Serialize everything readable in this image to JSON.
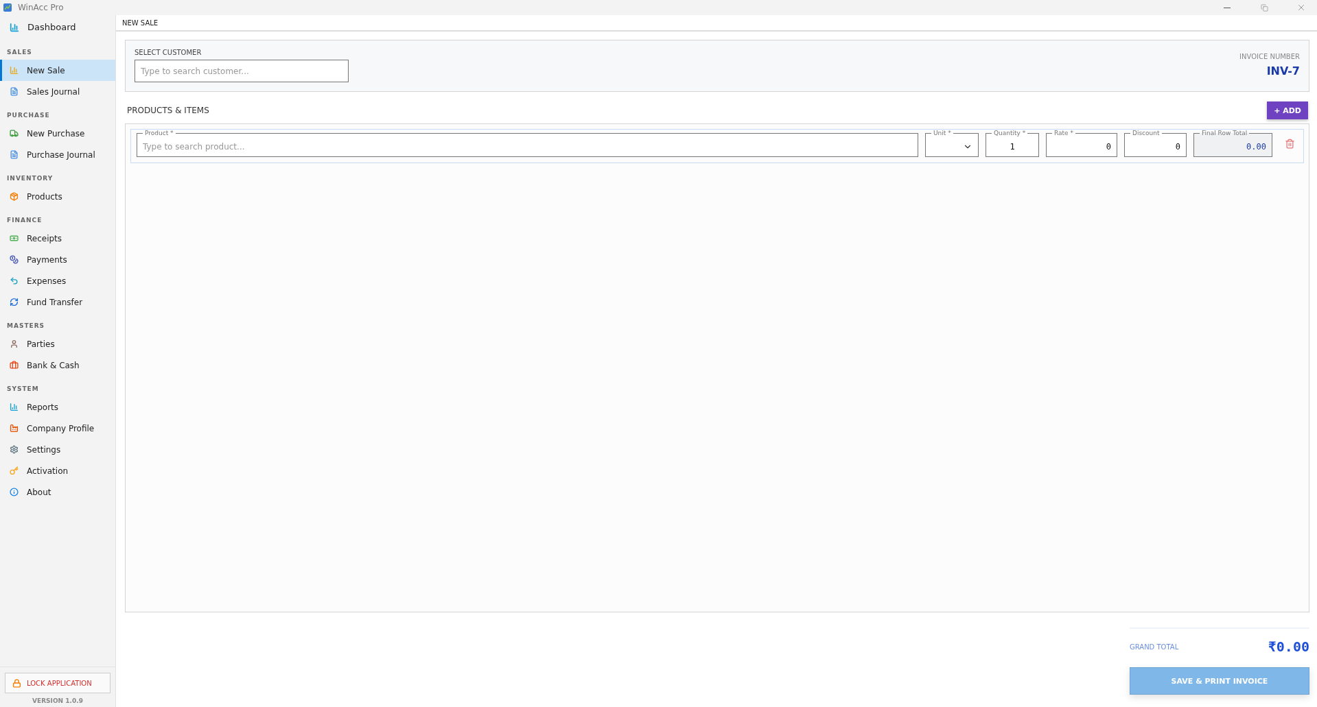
{
  "window": {
    "title": "WinAcc Pro"
  },
  "sidebar": {
    "home": {
      "label": "Dashboard"
    },
    "sections": [
      {
        "title": "SALES",
        "items": [
          {
            "label": "New Sale",
            "selected": true
          },
          {
            "label": "Sales Journal",
            "selected": false
          }
        ]
      },
      {
        "title": "PURCHASE",
        "items": [
          {
            "label": "New Purchase",
            "selected": false
          },
          {
            "label": "Purchase Journal",
            "selected": false
          }
        ]
      },
      {
        "title": "INVENTORY",
        "items": [
          {
            "label": "Products",
            "selected": false
          }
        ]
      },
      {
        "title": "FINANCE",
        "items": [
          {
            "label": "Receipts",
            "selected": false
          },
          {
            "label": "Payments",
            "selected": false
          },
          {
            "label": "Expenses",
            "selected": false
          },
          {
            "label": "Fund Transfer",
            "selected": false
          }
        ]
      },
      {
        "title": "MASTERS",
        "items": [
          {
            "label": "Parties",
            "selected": false
          },
          {
            "label": "Bank & Cash",
            "selected": false
          }
        ]
      },
      {
        "title": "SYSTEM",
        "items": [
          {
            "label": "Reports",
            "selected": false
          },
          {
            "label": "Company Profile",
            "selected": false
          },
          {
            "label": "Settings",
            "selected": false
          },
          {
            "label": "Activation",
            "selected": false
          },
          {
            "label": "About",
            "selected": false
          }
        ]
      }
    ],
    "lock_button": "LOCK APPLICATION",
    "version": "VERSION 1.0.9"
  },
  "page_title": "NEW SALE",
  "customer": {
    "label": "SELECT CUSTOMER",
    "placeholder": "Type to search customer..."
  },
  "invoice": {
    "label": "INVOICE NUMBER",
    "value": "INV-7"
  },
  "items_section": {
    "title": "PRODUCTS & ITEMS",
    "add_button": "ADD",
    "add_icon": "+"
  },
  "item_rows": [
    {
      "fields": [
        {
          "kind": "search",
          "label": "Product *",
          "placeholder": "Type to search product..."
        },
        {
          "kind": "select",
          "label": "Unit *"
        },
        {
          "kind": "quantity",
          "label": "Quantity *",
          "value": "1"
        },
        {
          "kind": "number",
          "label": "Rate *",
          "value": "0"
        },
        {
          "kind": "number",
          "label": "Discount",
          "value": "0"
        },
        {
          "kind": "total",
          "label": "Final Row Total",
          "value": "0.00"
        }
      ]
    }
  ],
  "grand_total": {
    "label": "GRAND TOTAL",
    "value": "₹0.00"
  },
  "save_button": {
    "label": "SAVE & PRINT INVOICE",
    "disabled": true
  }
}
